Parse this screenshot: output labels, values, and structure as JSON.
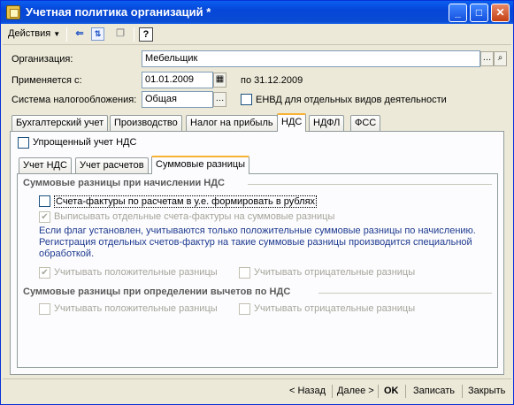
{
  "window": {
    "title": "Учетная политика организаций *"
  },
  "toolbar": {
    "actions_label": "Действия",
    "help_label": "?"
  },
  "form": {
    "organization_label": "Организация:",
    "organization_value": "Мебельщик",
    "applies_label": "Применяется с:",
    "applies_value": "01.01.2009",
    "to_label": "по 31.12.2009",
    "tax_system_label": "Система налогообложения:",
    "tax_system_value": "Общая",
    "envd_label": "ЕНВД для отдельных видов деятельности"
  },
  "tabs": [
    "Бухгалтерский учет",
    "Производство",
    "Налог на прибыль",
    "НДС",
    "НДФЛ",
    "ФСС"
  ],
  "nds": {
    "simplified_label": "Упрощенный учет НДС",
    "subtabs": [
      "Учет НДС",
      "Учет расчетов",
      "Суммовые разницы"
    ],
    "section1_title": "Суммовые разницы при начислении НДС",
    "invoice_currency_label": "Счета-фактуры по расчетам в у.е. формировать в рублях",
    "separate_invoices_label": "Выписывать отдельные счета-фактуры на суммовые разницы",
    "info_text": "Если флаг установлен, учитываются только положительные суммовые разницы по начислению. Регистрация отдельных счетов-фактур на такие суммовые разницы производится специальной обработкой.",
    "s1_positive_label": "Учитывать положительные разницы",
    "s1_negative_label": "Учитывать отрицательные разницы",
    "section2_title": "Суммовые разницы при определении вычетов по НДС",
    "s2_positive_label": "Учитывать положительные разницы",
    "s2_negative_label": "Учитывать отрицательные разницы"
  },
  "footer": {
    "back_label": "< Назад",
    "next_label": "Далее >",
    "ok_label": "OK",
    "save_label": "Записать",
    "close_label": "Закрыть"
  }
}
